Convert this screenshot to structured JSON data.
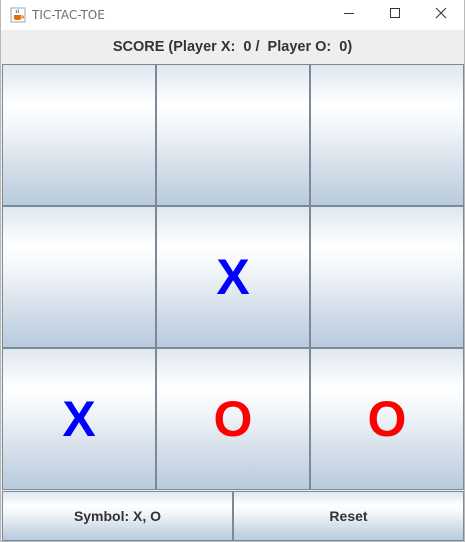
{
  "window": {
    "title": "TIC-TAC-TOE",
    "icons": {
      "app": "java-cup-icon",
      "minimize": "minimize-icon",
      "maximize": "maximize-icon",
      "close": "close-icon"
    }
  },
  "score": {
    "label": "SCORE (Player X:  0 /  Player O:  0)"
  },
  "board": {
    "cells": [
      {
        "value": "",
        "color": ""
      },
      {
        "value": "",
        "color": ""
      },
      {
        "value": "",
        "color": ""
      },
      {
        "value": "",
        "color": ""
      },
      {
        "value": "X",
        "color": "#0000ff"
      },
      {
        "value": "",
        "color": ""
      },
      {
        "value": "X",
        "color": "#0000ff"
      },
      {
        "value": "O",
        "color": "#ff0000"
      },
      {
        "value": "O",
        "color": "#ff0000"
      }
    ]
  },
  "buttons": {
    "symbol_label": "Symbol: X, O",
    "reset_label": "Reset"
  },
  "colors": {
    "player_x": "#0000ff",
    "player_o": "#ff0000"
  }
}
